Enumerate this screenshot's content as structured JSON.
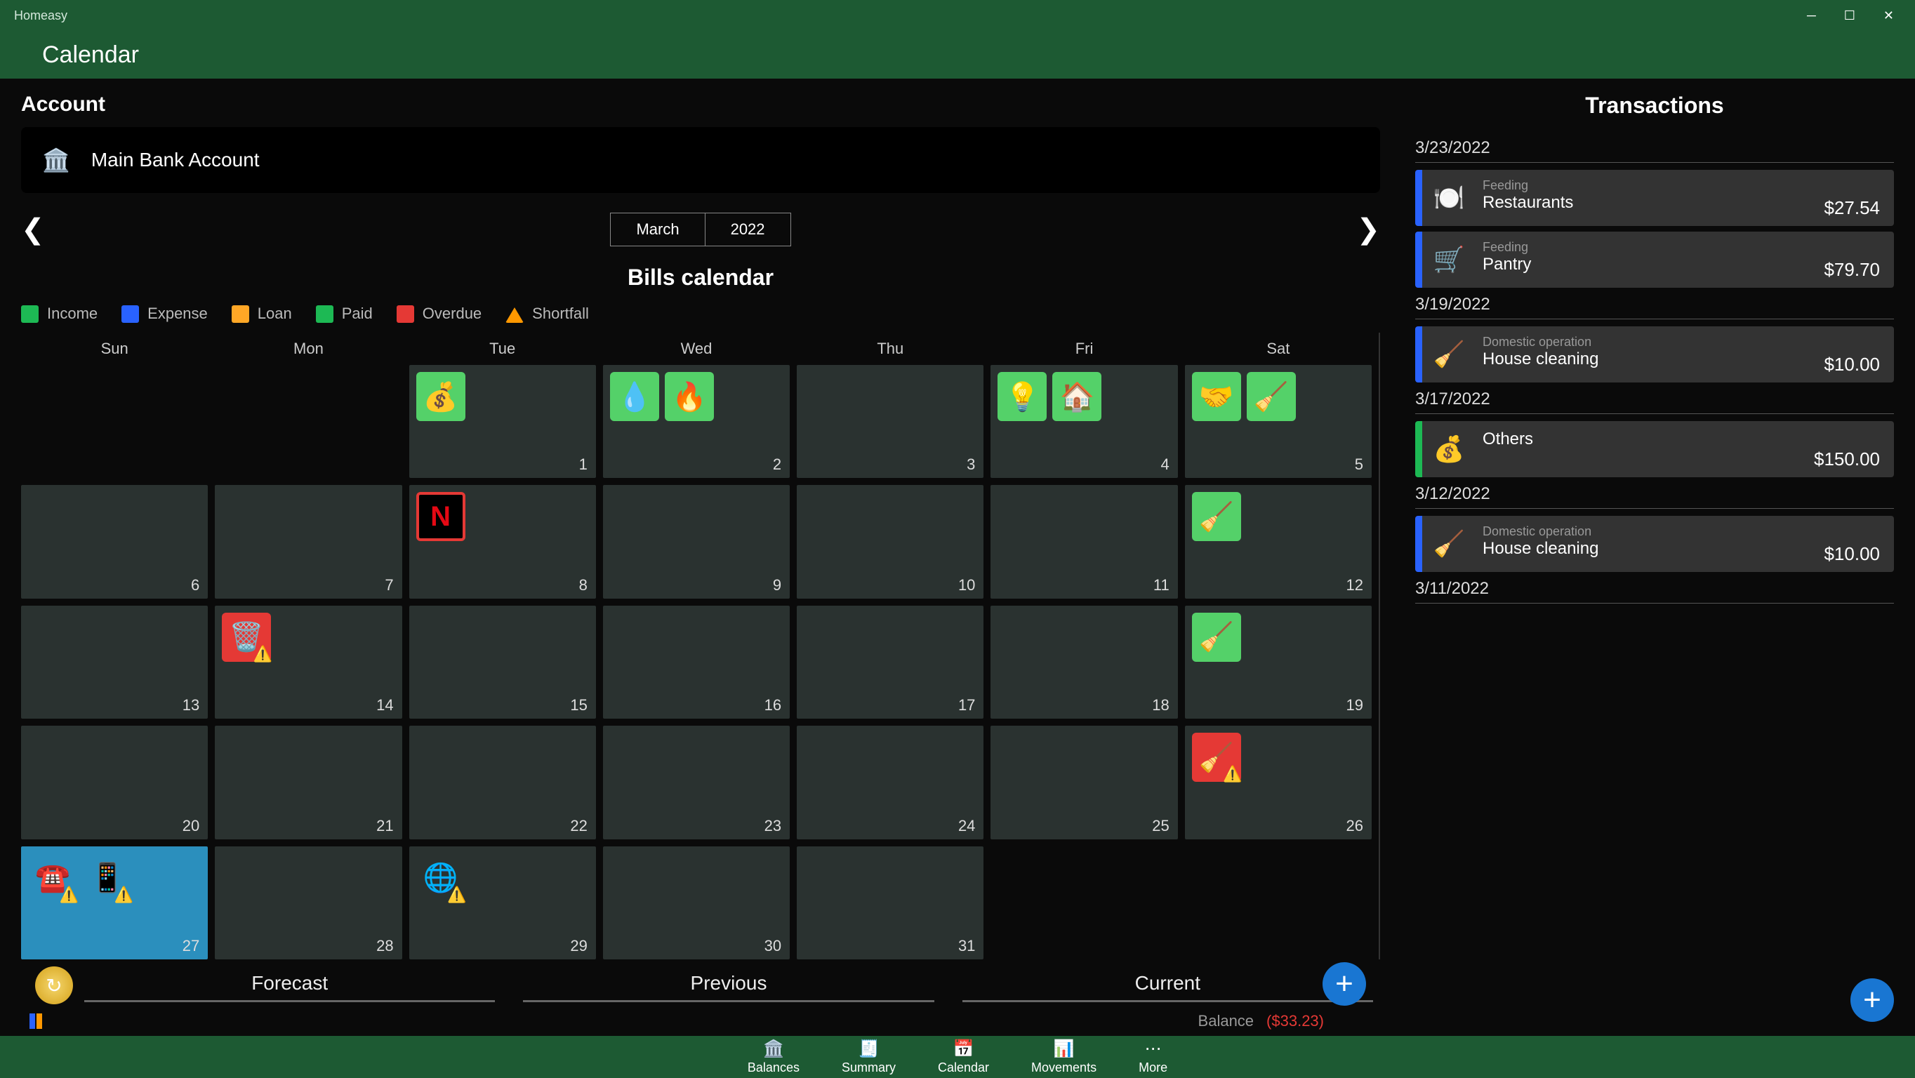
{
  "app_name": "Homeasy",
  "page_title": "Calendar",
  "account": {
    "label": "Account",
    "name": "Main Bank Account"
  },
  "month_nav": {
    "month": "March",
    "year": "2022"
  },
  "bills_title": "Bills calendar",
  "legend": {
    "income": "Income",
    "expense": "Expense",
    "loan": "Loan",
    "paid": "Paid",
    "overdue": "Overdue",
    "shortfall": "Shortfall"
  },
  "dow": [
    "Sun",
    "Mon",
    "Tue",
    "Wed",
    "Thu",
    "Fri",
    "Sat"
  ],
  "bottom_tabs": {
    "forecast": "Forecast",
    "previous": "Previous",
    "current": "Current"
  },
  "balance": {
    "label": "Balance",
    "value": "($33.23)"
  },
  "transactions_title": "Transactions",
  "tx": [
    {
      "date": "3/23/2022",
      "items": [
        {
          "icon": "🍽️",
          "cat": "Feeding",
          "name": "Restaurants",
          "amt": "$27.54",
          "type": "expense"
        },
        {
          "icon": "🛒",
          "cat": "Feeding",
          "name": "Pantry",
          "amt": "$79.70",
          "type": "expense"
        }
      ]
    },
    {
      "date": "3/19/2022",
      "items": [
        {
          "icon": "🧹",
          "cat": "Domestic operation",
          "name": "House cleaning",
          "amt": "$10.00",
          "type": "expense"
        }
      ]
    },
    {
      "date": "3/17/2022",
      "items": [
        {
          "icon": "💰",
          "cat": "",
          "name": "Others",
          "amt": "$150.00",
          "type": "income"
        }
      ]
    },
    {
      "date": "3/12/2022",
      "items": [
        {
          "icon": "🧹",
          "cat": "Domestic operation",
          "name": "House cleaning",
          "amt": "$10.00",
          "type": "expense"
        }
      ]
    },
    {
      "date": "3/11/2022",
      "items": []
    }
  ],
  "nav": {
    "balances": "Balances",
    "summary": "Summary",
    "calendar": "Calendar",
    "movements": "Movements",
    "more": "More"
  },
  "cal": [
    {
      "d": "",
      "cls": "empty"
    },
    {
      "d": "",
      "cls": "empty"
    },
    {
      "d": "1",
      "bills": [
        {
          "icon": "💰",
          "st": "paid"
        }
      ]
    },
    {
      "d": "2",
      "bills": [
        {
          "icon": "💧",
          "st": "paid"
        },
        {
          "icon": "🔥",
          "st": "paid"
        }
      ]
    },
    {
      "d": "3"
    },
    {
      "d": "4",
      "bills": [
        {
          "icon": "💡",
          "st": "paid"
        },
        {
          "icon": "🏠",
          "st": "paid"
        }
      ]
    },
    {
      "d": "5",
      "bills": [
        {
          "icon": "🤝",
          "st": "paid"
        },
        {
          "icon": "🧹",
          "st": "paid"
        }
      ]
    },
    {
      "d": "6"
    },
    {
      "d": "7"
    },
    {
      "d": "8",
      "bills": [
        {
          "icon": "N",
          "st": "overdue",
          "netflix": true
        }
      ]
    },
    {
      "d": "9"
    },
    {
      "d": "10"
    },
    {
      "d": "11"
    },
    {
      "d": "12",
      "bills": [
        {
          "icon": "🧹",
          "st": "paid"
        }
      ]
    },
    {
      "d": "13"
    },
    {
      "d": "14",
      "bills": [
        {
          "icon": "🗑️",
          "st": "overdue",
          "warn": true
        }
      ]
    },
    {
      "d": "15"
    },
    {
      "d": "16"
    },
    {
      "d": "17"
    },
    {
      "d": "18"
    },
    {
      "d": "19",
      "bills": [
        {
          "icon": "🧹",
          "st": "paid"
        }
      ]
    },
    {
      "d": "20"
    },
    {
      "d": "21"
    },
    {
      "d": "22"
    },
    {
      "d": "23"
    },
    {
      "d": "24"
    },
    {
      "d": "25"
    },
    {
      "d": "26",
      "bills": [
        {
          "icon": "🧹",
          "st": "overdue",
          "warn": true
        }
      ]
    },
    {
      "d": "27",
      "today": true,
      "bills": [
        {
          "icon": "☎️",
          "st": "none",
          "warn": true
        },
        {
          "icon": "📱",
          "st": "none",
          "warn": true
        }
      ]
    },
    {
      "d": "28"
    },
    {
      "d": "29",
      "bills": [
        {
          "icon": "🌐",
          "st": "none",
          "warn": true
        }
      ]
    },
    {
      "d": "30"
    },
    {
      "d": "31"
    }
  ]
}
